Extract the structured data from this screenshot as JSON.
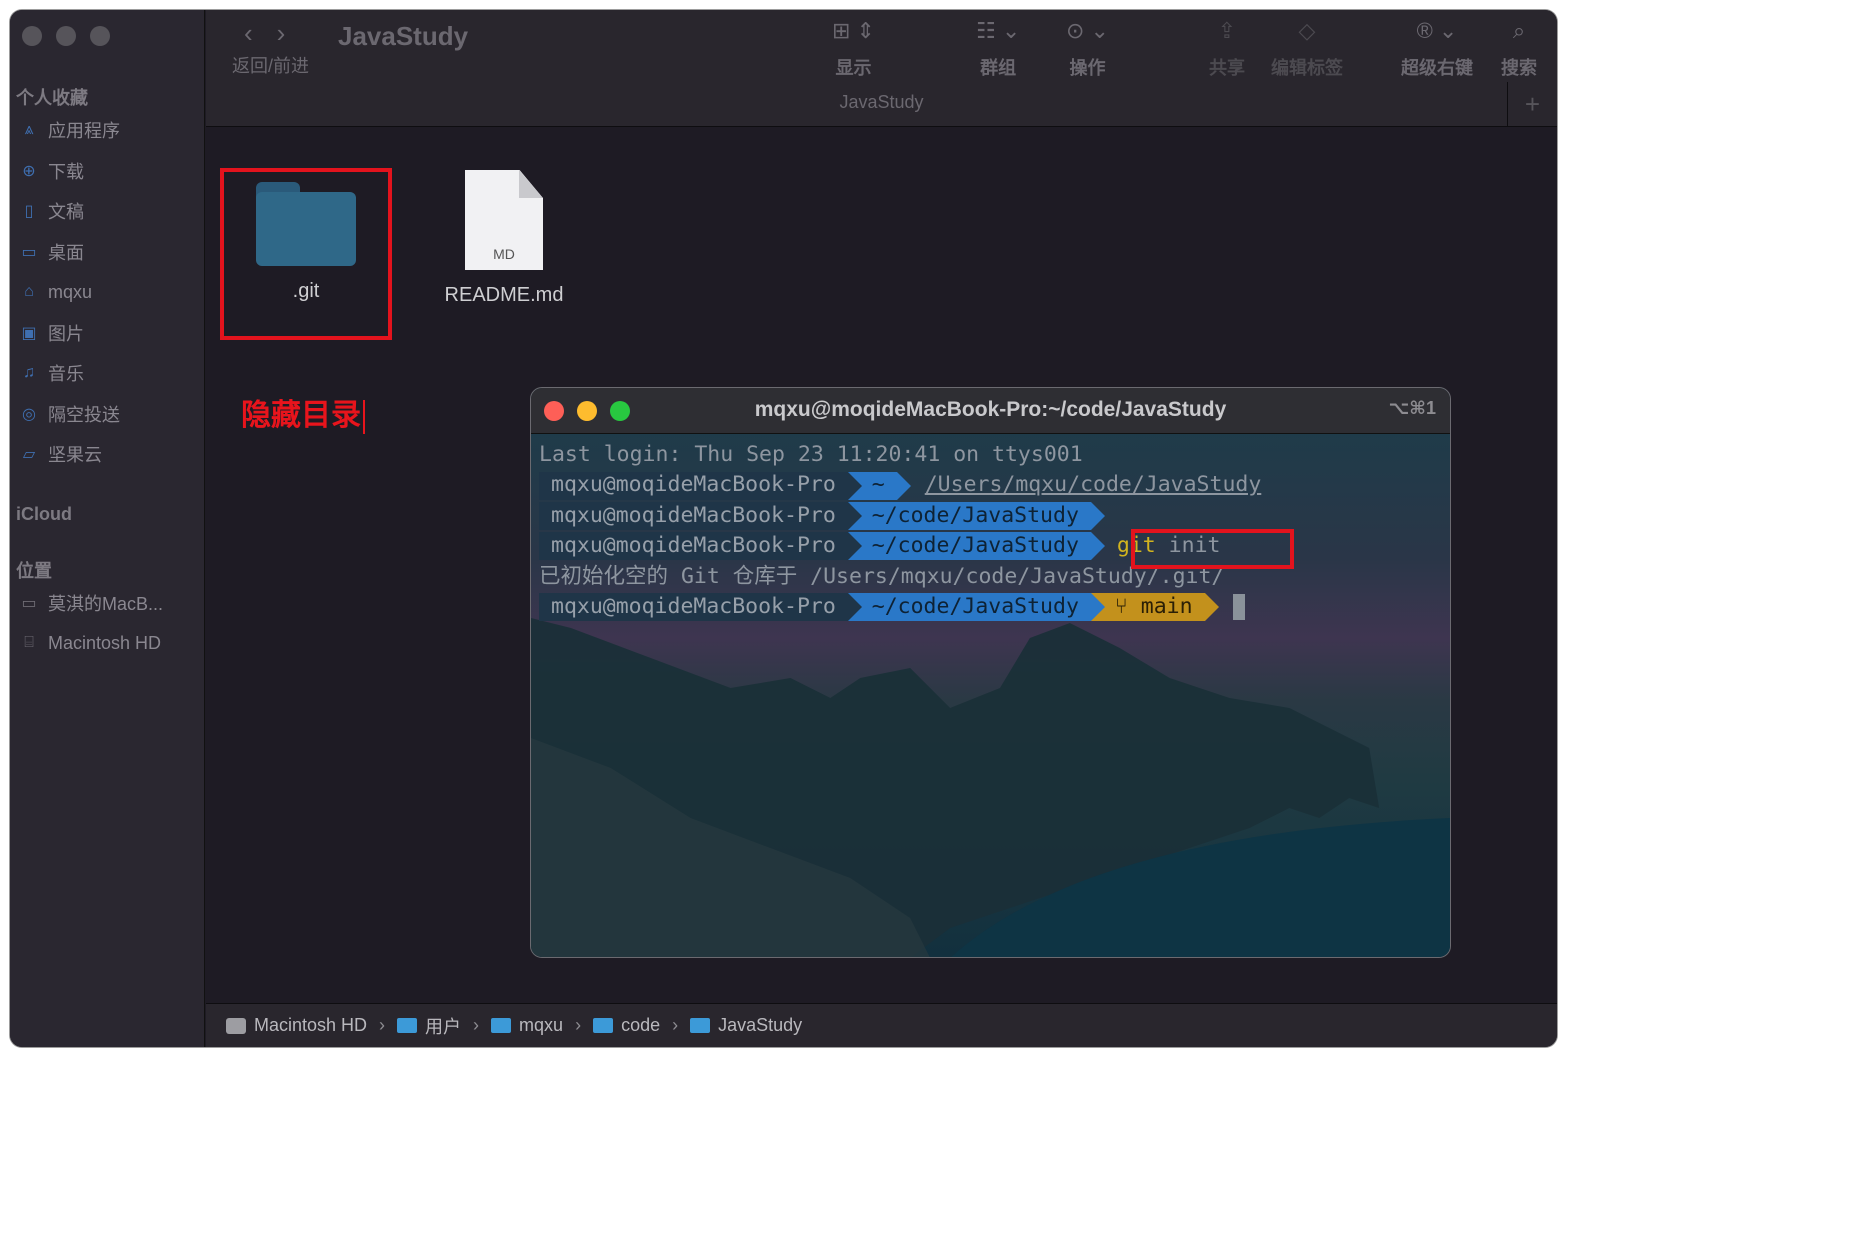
{
  "finder": {
    "window_title": "JavaStudy",
    "nav_label": "返回/前进",
    "path_title": "JavaStudy",
    "toolbar": [
      {
        "label": "显示",
        "icon": "grid-view-icon"
      },
      {
        "label": "群组",
        "icon": "group-icon"
      },
      {
        "label": "操作",
        "icon": "action-ellipsis-icon"
      },
      {
        "label": "共享",
        "icon": "share-icon"
      },
      {
        "label": "编辑标签",
        "icon": "tag-icon"
      },
      {
        "label": "超级右键",
        "icon": "registered-icon"
      },
      {
        "label": "搜索",
        "icon": "search-icon"
      }
    ],
    "sidebar": {
      "favorites_title": "个人收藏",
      "favorites": [
        {
          "label": "应用程序",
          "icon": "applications-icon"
        },
        {
          "label": "下载",
          "icon": "download-icon"
        },
        {
          "label": "文稿",
          "icon": "document-icon"
        },
        {
          "label": "桌面",
          "icon": "desktop-icon"
        },
        {
          "label": "mqxu",
          "icon": "home-icon"
        },
        {
          "label": "图片",
          "icon": "pictures-icon"
        },
        {
          "label": "音乐",
          "icon": "music-icon"
        },
        {
          "label": "隔空投送",
          "icon": "airdrop-icon"
        },
        {
          "label": "坚果云",
          "icon": "folder-icon"
        }
      ],
      "icloud_title": "iCloud",
      "locations_title": "位置",
      "locations": [
        {
          "label": "莫淇的MacB...",
          "icon": "laptop-icon"
        },
        {
          "label": "Macintosh HD",
          "icon": "disk-icon"
        }
      ]
    },
    "files": [
      {
        "name": ".git",
        "kind": "folder"
      },
      {
        "name": "README.md",
        "kind": "document",
        "tag": "MD"
      }
    ],
    "annotation": "隐藏目录",
    "pathbar": [
      "Macintosh HD",
      "用户",
      "mqxu",
      "code",
      "JavaStudy"
    ]
  },
  "terminal": {
    "title": "mqxu@moqideMacBook-Pro:~/code/JavaStudy",
    "shortcut": "⌥⌘1",
    "last_login": "Last login: Thu Sep 23 11:20:41 on ttys001",
    "host": "mqxu@moqideMacBook-Pro",
    "line1_dir": "~",
    "line1_path": "/Users/mqxu/code/JavaStudy",
    "dir": "~/code/JavaStudy",
    "cmd_git": "git",
    "cmd_rest": " init",
    "init_output": "已初始化空的 Git 仓库于 /Users/mqxu/code/JavaStudy/.git/",
    "branch": "main",
    "branch_icon": "git-branch-icon"
  },
  "colors": {
    "highlight": "#e3131d",
    "prompt_dir": "#2a78c8",
    "prompt_git": "#c3911c",
    "traffic_close": "#fe5f57",
    "traffic_min": "#febc2e",
    "traffic_max": "#28c840"
  }
}
